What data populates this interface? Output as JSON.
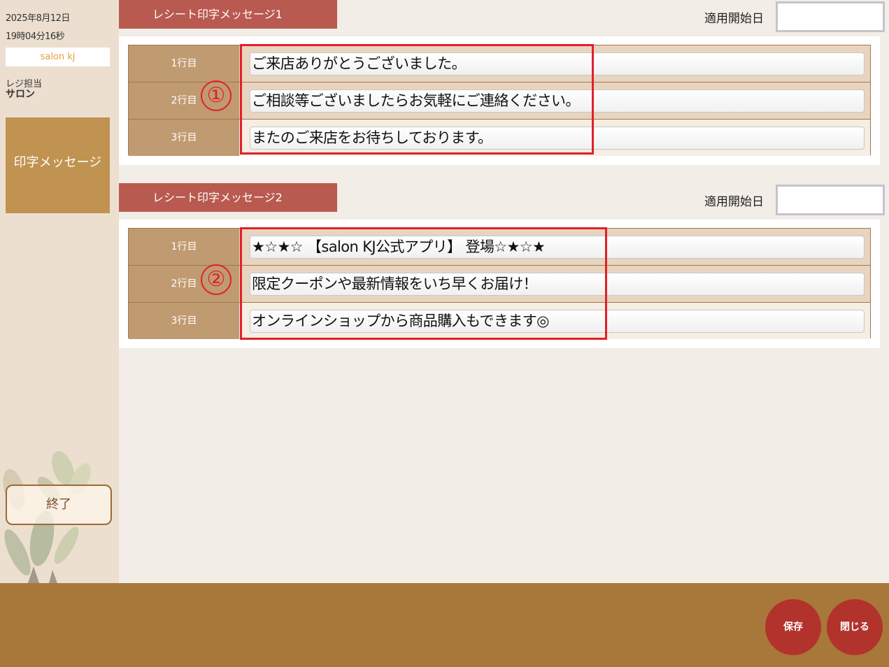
{
  "sidebar": {
    "date": "2025年8月12日",
    "time": "19時04分16秒",
    "store_name": "salon kj",
    "staff_label": "レジ担当",
    "staff_name": "サロン",
    "menu_item": "印字メッセージ",
    "end_button": "終了"
  },
  "section1": {
    "title": "レシート印字メッセージ1",
    "start_date_label": "適用開始日",
    "start_date_value": "",
    "annotation_number": "①",
    "rows": [
      {
        "label": "1行目",
        "value": "ご来店ありがとうございました。"
      },
      {
        "label": "2行目",
        "value": "ご相談等ございましたらお気軽にご連絡ください。"
      },
      {
        "label": "3行目",
        "value": "またのご来店をお待ちしております。"
      }
    ]
  },
  "section2": {
    "title": "レシート印字メッセージ2",
    "start_date_label": "適用開始日",
    "start_date_value": "",
    "annotation_number": "②",
    "rows": [
      {
        "label": "1行目",
        "value": "★☆★☆ 【salon KJ公式アプリ】 登場☆★☆★"
      },
      {
        "label": "2行目",
        "value": "限定クーポンや最新情報をいち早くお届け！"
      },
      {
        "label": "3行目",
        "value": "オンラインショップから商品購入もできます◎"
      }
    ]
  },
  "footer": {
    "save_button": "保存",
    "close_button": "閉じる"
  },
  "colors": {
    "section_title_bg": "#b95a50",
    "row_label_bg": "#c09a70",
    "menu_active_bg": "#c09350",
    "footer_bg": "#a8773a",
    "round_button_bg": "#b2322c",
    "highlight_border": "#e0202a"
  }
}
